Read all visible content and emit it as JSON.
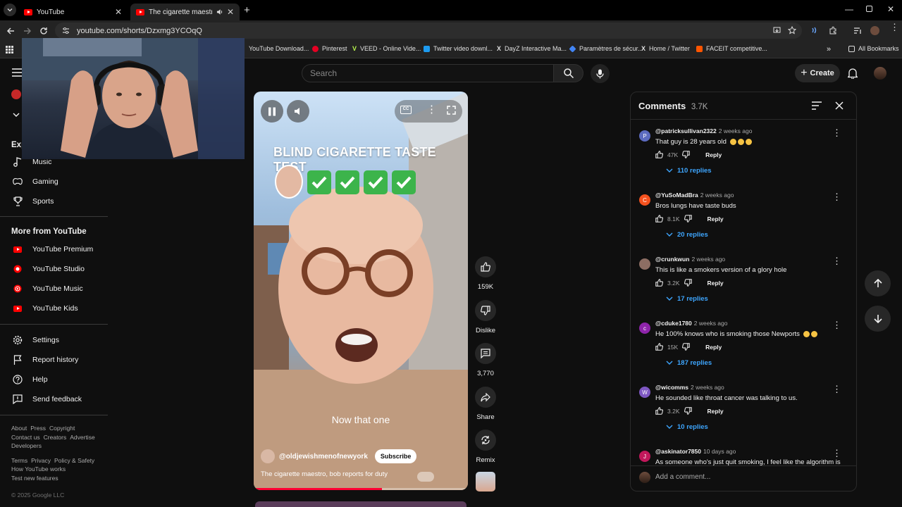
{
  "browser": {
    "tabs": [
      {
        "title": "YouTube"
      },
      {
        "title": "The cigarette maestro, bob"
      }
    ],
    "url": "youtube.com/shorts/Dzxmg3YCOqQ",
    "bookmarks": [
      "YouTube Download...",
      "Pinterest",
      "VEED - Online Vide...",
      "Twitter video downl...",
      "DayZ Interactive Ma...",
      "Paramètres de sécur...",
      "Home / Twitter",
      "FACEIT competitive..."
    ],
    "all_bookmarks": "All Bookmarks"
  },
  "header": {
    "search_placeholder": "Search",
    "create_label": "Create"
  },
  "sidebar": {
    "explore_partial": "Exp",
    "explore_items": [
      "Music",
      "Gaming",
      "Sports"
    ],
    "more_heading": "More from YouTube",
    "more_items": [
      "YouTube Premium",
      "YouTube Studio",
      "YouTube Music",
      "YouTube Kids"
    ],
    "settings_items": [
      "Settings",
      "Report history",
      "Help",
      "Send feedback"
    ],
    "footer1": [
      "About",
      "Press",
      "Copyright"
    ],
    "footer2": [
      "Contact us",
      "Creators",
      "Advertise"
    ],
    "footer3": [
      "Developers"
    ],
    "footer4": [
      "Terms",
      "Privacy",
      "Policy & Safety"
    ],
    "footer5": [
      "How YouTube works"
    ],
    "footer6": [
      "Test new features"
    ],
    "copyright": "© 2025 Google LLC"
  },
  "video": {
    "overlay_title": "BLIND CIGARETTE TASTE TEST",
    "caption": "Now that one",
    "channel": "@oldjewishmenofnewyork",
    "subscribe": "Subscribe",
    "description": "The cigarette maestro, bob reports for duty"
  },
  "actions": {
    "likes": "159K",
    "dislike": "Dislike",
    "comments": "3,770",
    "share": "Share",
    "remix": "Remix"
  },
  "comments_panel": {
    "title": "Comments",
    "count": "3.7K",
    "add_placeholder": "Add a comment...",
    "reply_label": "Reply",
    "items": [
      {
        "user": "@patricksullivan2322",
        "time": "2 weeks ago",
        "text": "That guy is 28 years old",
        "likes": "47K",
        "replies": "110 replies",
        "initial": "P",
        "color": "#5c6bc0"
      },
      {
        "user": "@YuSoMadBra",
        "time": "2 weeks ago",
        "text": "Bros lungs have taste buds",
        "likes": "8.1K",
        "replies": "20 replies",
        "initial": "C",
        "color": "#f4511e"
      },
      {
        "user": "@crunkwun",
        "time": "2 weeks ago",
        "text": "This is like a smokers version of a glory hole",
        "likes": "3.2K",
        "replies": "17 replies",
        "initial": "",
        "color": "#8d6e63"
      },
      {
        "user": "@cduke1780",
        "time": "2 weeks ago",
        "text": "He 100% knows who is smoking those Newports",
        "likes": "15K",
        "replies": "187 replies",
        "initial": "c",
        "color": "#8e24aa"
      },
      {
        "user": "@wicomms",
        "time": "2 weeks ago",
        "text": "He sounded like throat cancer was talking to us.",
        "likes": "3.2K",
        "replies": "10 replies",
        "initial": "W",
        "color": "#7e57c2"
      },
      {
        "user": "@askinator7850",
        "time": "10 days ago",
        "text": "As someone who's just quit smoking, I feel like the algorithm is",
        "likes": "",
        "replies": "",
        "initial": "J",
        "color": "#c2185b"
      }
    ]
  }
}
